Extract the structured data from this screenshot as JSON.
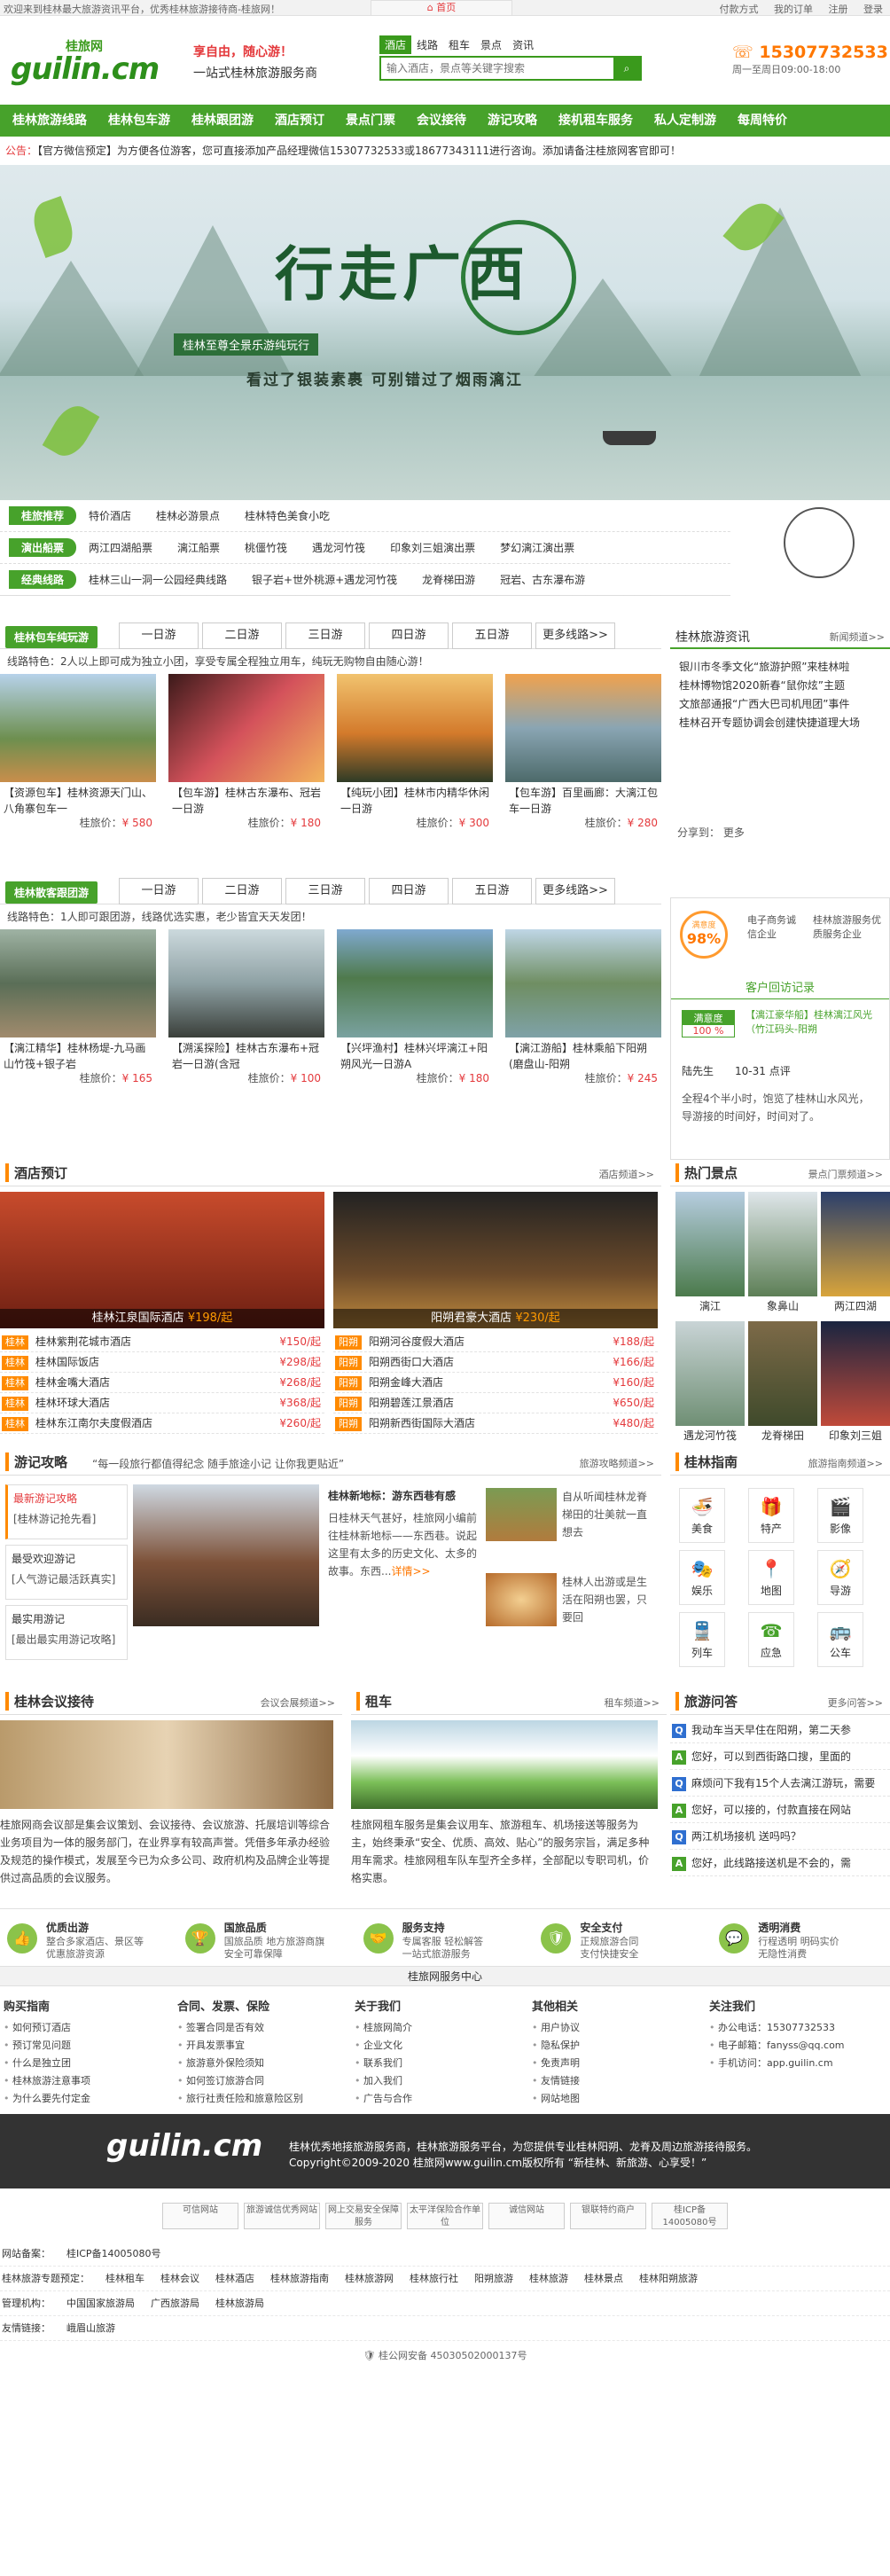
{
  "topbar": {
    "welcome": "欢迎来到桂林最大旅游资讯平台，优秀桂林旅游接待商-桂旅网！",
    "home": "首页",
    "links": [
      "付款方式",
      "我的订单",
      "注册",
      "登录"
    ]
  },
  "header": {
    "brand": "桂旅网",
    "domain": "guilin.cm",
    "slogan1": "享自由，随心游！",
    "slogan2": "一站式桂林旅游服务商",
    "search_tabs": [
      "酒店",
      "线路",
      "租车",
      "景点",
      "资讯"
    ],
    "search_placeholder": "输入酒店，景点等关键字搜索",
    "phone": "15307732533",
    "hours": "周一至周日09:00-18:00"
  },
  "nav": [
    "桂林旅游线路",
    "桂林包车游",
    "桂林跟团游",
    "酒店预订",
    "景点门票",
    "会议接待",
    "游记攻略",
    "接机租车服务",
    "私人定制游",
    "每周特价"
  ],
  "notice": {
    "label": "公告：",
    "text": "【官方微信预定】为方便各位游客，您可直接添加产品经理微信15307732533或18677343111进行咨询。添加请备注桂旅网客官即可！"
  },
  "banner": {
    "title": "行走广西",
    "sub1": "桂林至尊全景乐游纯玩行",
    "sub2": "看过了银装素裹 可别错过了烟雨漓江"
  },
  "tagrows": [
    {
      "label": "桂旅推荐",
      "items": [
        "特价酒店",
        "桂林必游景点",
        "桂林特色美食小吃"
      ]
    },
    {
      "label": "演出船票",
      "items": [
        "两江四湖船票",
        "漓江船票",
        "桃僵竹筏",
        "遇龙河竹筏",
        "印象刘三姐演出票",
        "梦幻漓江演出票"
      ]
    },
    {
      "label": "经典线路",
      "items": [
        "桂林三山一洞一公园经典线路",
        "银子岩+世外桃源+遇龙河竹筏",
        "龙脊梯田游",
        "冠岩、古东瀑布游"
      ]
    }
  ],
  "package": {
    "title": "桂林包车纯玩游",
    "days": [
      "一日游",
      "二日游",
      "三日游",
      "四日游",
      "五日游",
      "更多线路>>"
    ],
    "feature": "线路特色：2人以上即可成为独立小团，享受专属全程独立用车，纯玩无购物自由随心游！",
    "products": [
      {
        "name": "【资源包车】桂林资源天门山、八角寨包车一",
        "price": "580"
      },
      {
        "name": "【包车游】桂林古东瀑布、冠岩一日游",
        "price": "180"
      },
      {
        "name": "【纯玩小团】桂林市内精华休闲一日游",
        "price": "300"
      },
      {
        "name": "【包车游】百里画廊：大漓江包车一日游",
        "price": "280"
      }
    ]
  },
  "group": {
    "title": "桂林散客跟团游",
    "days": [
      "一日游",
      "二日游",
      "三日游",
      "四日游",
      "五日游",
      "更多线路>>"
    ],
    "feature": "线路特色：1人即可跟团游，线路优选实惠，老少皆宜天天发团！",
    "products": [
      {
        "name": "【漓江精华】桂林杨堤-九马画山竹筏+银子岩",
        "price": "165"
      },
      {
        "name": "【溯溪探险】桂林古东瀑布+冠岩一日游(含冠",
        "price": "100"
      },
      {
        "name": "【兴坪渔村】桂林兴坪漓江+阳朔风光一日游A",
        "price": "180"
      },
      {
        "name": "【漓江游船】桂林乘船下阳朔(磨盘山-阳朔",
        "price": "245"
      }
    ]
  },
  "price_label": "桂旅价：",
  "news": {
    "title": "桂林旅游资讯",
    "more": "新闻频道>>",
    "items": [
      "银川市冬季文化“旅游护照”来桂林啦",
      "桂林博物馆2020新春“鼠你炫”主题",
      "文旅部通报“广西大巴司机甩团”事件",
      "桂林召开专题协调会创建快捷道理大场"
    ],
    "share": "分享到：   更多"
  },
  "satisfaction": {
    "label": "满意度",
    "value": "98%",
    "cols": [
      "电子商务诚信企业",
      "桂林旅游服务优质服务企业"
    ],
    "review_title": "客户回访记录",
    "rate_label": "满意度",
    "rate": "100 %",
    "review_line": "【漓江豪华船】桂林漓江风光（竹江码头-阳朔",
    "user": "陆先生",
    "time": "10-31 点评",
    "review": "全程4个半小时，饱览了桂林山水风光，导游接的时间好，时间对了。"
  },
  "hotels": {
    "title": "酒店预订",
    "more": "酒店频道>>",
    "feature": [
      {
        "name": "桂林江泉国际酒店",
        "price": "198/起"
      },
      {
        "name": "阳朔君豪大酒店",
        "price": "230/起"
      }
    ],
    "tag1": "桂林",
    "tag2": "阳朔",
    "left": [
      {
        "name": "桂林紫荆花城市酒店",
        "price": "150/起"
      },
      {
        "name": "桂林国际饭店",
        "price": "298/起"
      },
      {
        "name": "桂林金嘴大酒店",
        "price": "268/起"
      },
      {
        "name": "桂林环球大酒店",
        "price": "368/起"
      },
      {
        "name": "桂林东江南尔夫度假酒店",
        "price": "260/起"
      }
    ],
    "right": [
      {
        "name": "阳朔河谷度假大酒店",
        "price": "188/起"
      },
      {
        "name": "阳朔西街口大酒店",
        "price": "166/起"
      },
      {
        "name": "阳朔金峰大酒店",
        "price": "160/起"
      },
      {
        "name": "阳朔碧莲江景酒店",
        "price": "650/起"
      },
      {
        "name": "阳朔新西街国际大酒店",
        "price": "480/起"
      }
    ]
  },
  "scenic": {
    "title": "热门景点",
    "more": "景点门票频道>>",
    "items": [
      "漓江",
      "象鼻山",
      "两江四湖",
      "遇龙河竹筏",
      "龙脊梯田",
      "印象刘三姐"
    ]
  },
  "travel": {
    "title": "游记攻略",
    "slogan": "“每一段旅行都值得纪念 随手旅途小记 让你我更贴近”",
    "more": "旅游攻略频道>>",
    "tabs": [
      {
        "t": "最新游记攻略",
        "s": "[桂林游记抢先看]"
      },
      {
        "t": "最受欢迎游记",
        "s": "[人气游记最活跃真实]"
      },
      {
        "t": "最实用游记",
        "s": "[最出最实用游记攻略]"
      }
    ],
    "article_title": "桂林新地标：游东西巷有感",
    "article": "日桂林天气甚好，桂旅网小编前往桂林新地标——东西巷。说起这里有太多的历史文化、太多的故事。东西...",
    "more_link": "详情>>",
    "side1": "自从听闻桂林龙脊梯田的壮美就一直想去",
    "side2": "桂林人出游或是生活在阳朔也罢，只要回"
  },
  "guide": {
    "title": "桂林指南",
    "more": "旅游指南频道>>",
    "items": [
      {
        "i": "🍜",
        "l": "美食"
      },
      {
        "i": "🎁",
        "l": "特产"
      },
      {
        "i": "🎬",
        "l": "影像"
      },
      {
        "i": "🎭",
        "l": "娱乐"
      },
      {
        "i": "📍",
        "l": "地图"
      },
      {
        "i": "🧭",
        "l": "导游"
      },
      {
        "i": "🚆",
        "l": "列车"
      },
      {
        "i": "☎",
        "l": "应急"
      },
      {
        "i": "🚌",
        "l": "公车"
      }
    ]
  },
  "meeting": {
    "title": "桂林会议接待",
    "more": "会议会展频道>>",
    "text": "桂旅网商会议部是集会议策划、会议接待、会议旅游、托展培训等综合业务项目为一体的服务部门，在业界享有较高声誉。凭借多年承办经验及规范的操作模式，发展至今已为众多公司、政府机构及品牌企业等提供过高品质的会议服务。"
  },
  "rental": {
    "title": "租车",
    "more": "租车频道>>",
    "text": "桂旅网租车服务是集会议用车、旅游租车、机场接送等服务为主，始终秉承“安全、优质、高效、贴心”的服务宗旨，满足多种用车需求。桂旅网租车队车型齐全多样，全部配以专职司机，价格实惠。"
  },
  "qa": {
    "title": "旅游问答",
    "more": "更多问答>>",
    "items": [
      {
        "k": "Q",
        "t": "我动车当天早住在阳朔，第二天参"
      },
      {
        "k": "A",
        "t": "您好，可以到西街路口搜，里面的"
      },
      {
        "k": "Q",
        "t": "麻烦问下我有15个人去漓江游玩，需要"
      },
      {
        "k": "A",
        "t": "您好，可以接的，付款直接在网站"
      },
      {
        "k": "Q",
        "t": "两江机场接机 送吗吗？"
      },
      {
        "k": "A",
        "t": "您好，此线路接送机是不会的，需"
      }
    ]
  },
  "services": [
    {
      "i": "👍",
      "t": "优质出游",
      "d1": "整合多家酒店、景区等",
      "d2": "优惠旅游资源"
    },
    {
      "i": "🏆",
      "t": "国旅品质",
      "d1": "国旅品质 地方旅游商旗",
      "d2": "安全可靠保障"
    },
    {
      "i": "🤝",
      "t": "服务支持",
      "d1": "专属客服 轻松解答",
      "d2": "一站式旅游服务"
    },
    {
      "i": "🛡",
      "t": "安全支付",
      "d1": "正规旅游合同",
      "d2": "支付快捷安全"
    },
    {
      "i": "💬",
      "t": "透明消费",
      "d1": "行程透明 明码实价",
      "d2": "无隐性消费"
    }
  ],
  "svcbar": "桂旅网服务中心",
  "footcols": [
    {
      "h": "购买指南",
      "items": [
        "如何预订酒店",
        "预订常见问题",
        "什么是独立团",
        "桂林旅游注意事项",
        "为什么要先付定金"
      ]
    },
    {
      "h": "合同、发票、保险",
      "items": [
        "签署合同是否有效",
        "开具发票事宜",
        "旅游意外保险须知",
        "如何签订旅游合同",
        "旅行社责任险和旅意险区别"
      ]
    },
    {
      "h": "关于我们",
      "items": [
        "桂旅网简介",
        "企业文化",
        "联系我们",
        "加入我们",
        "广告与合作"
      ]
    },
    {
      "h": "其他相关",
      "items": [
        "用户协议",
        "隐私保护",
        "免责声明",
        "友情链接",
        "网站地图"
      ]
    },
    {
      "h": "关注我们",
      "items": [
        "办公电话：15307732533",
        "电子邮箱：fanyss@qq.com",
        "手机访问：app.guilin.cm"
      ]
    }
  ],
  "darkfoot": {
    "logo": "guilin.cm",
    "l1": "桂林优秀地接旅游服务商，桂林旅游服务平台，为您提供专业桂林阳朔、龙脊及周边旅游接待服务。",
    "l2": "Copyright©2009-2020 桂旅网www.guilin.cm版权所有 “新桂林、新旅游、心享受！”"
  },
  "badges": [
    "可信网站",
    "旅游诚信优秀网站",
    "网上交易安全保障服务",
    "太平洋保险合作单位",
    "诚信网站",
    "银联特约商户",
    "桂ICP备14005080号"
  ],
  "footlinks": [
    {
      "label": "网站备案：",
      "items": [
        "桂ICP备14005080号"
      ]
    },
    {
      "label": "桂林旅游专题预定：",
      "items": [
        "桂林租车",
        "桂林会议",
        "桂林酒店",
        "桂林旅游指南",
        "桂林旅游网",
        "桂林旅行社",
        "阳朔旅游",
        "桂林旅游",
        "桂林景点",
        "桂林阳朔旅游"
      ]
    },
    {
      "label": "管理机构：",
      "items": [
        "中国国家旅游局",
        "广西旅游局",
        "桂林旅游局"
      ]
    },
    {
      "label": "友情链接：",
      "items": [
        "峨眉山旅游"
      ]
    }
  ],
  "police": "桂公网安备 45030502000137号"
}
